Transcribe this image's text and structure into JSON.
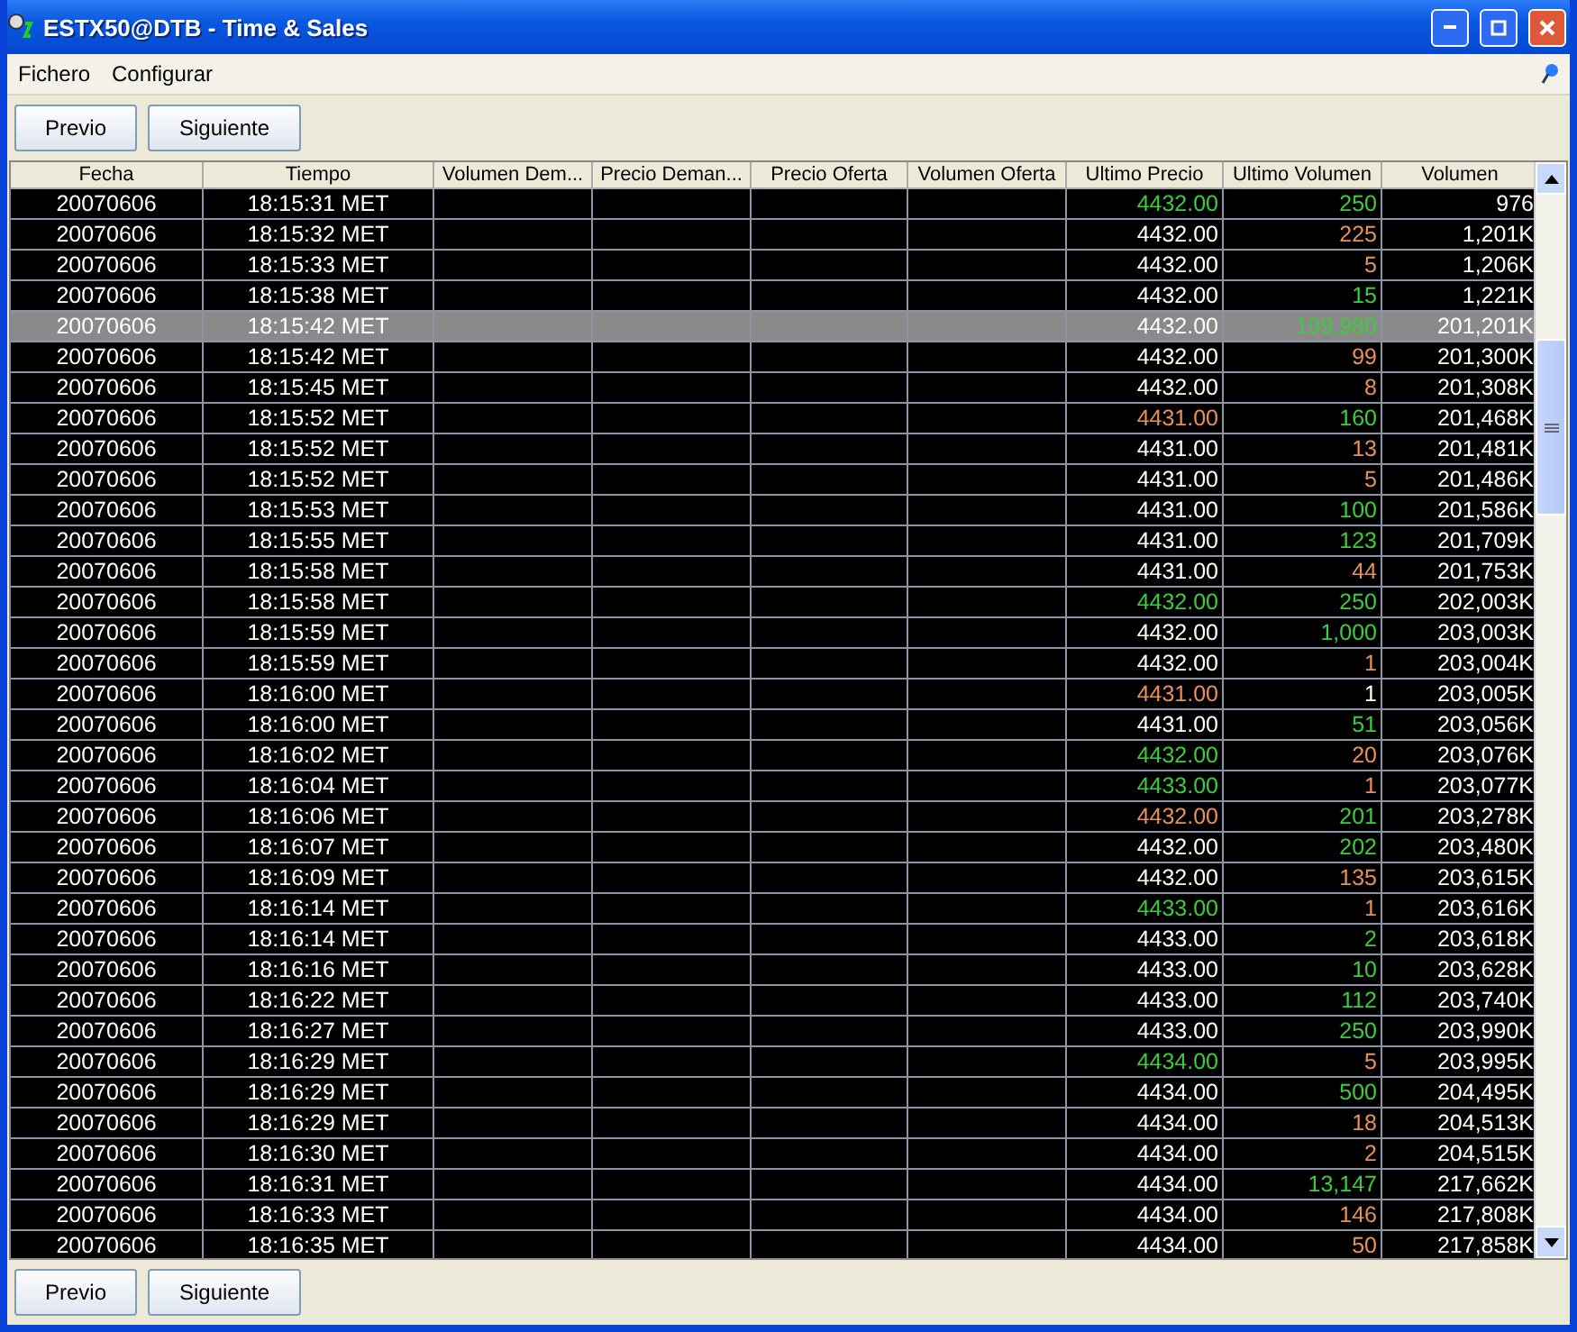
{
  "window": {
    "title": "ESTX50@DTB - Time & Sales"
  },
  "menu": [
    "Fichero",
    "Configurar"
  ],
  "top_buttons": [
    "Previo",
    "Siguiente"
  ],
  "table": {
    "columns": [
      "Fecha",
      "Tiempo",
      "Volumen Dem...",
      "Precio Deman...",
      "Precio Oferta",
      "Volumen Oferta",
      "Ultimo Precio",
      "Ultimo Volumen",
      "Volumen"
    ],
    "rows": [
      {
        "date": "20070606",
        "time": "18:15:31 MET",
        "price": {
          "text": "4432.00",
          "rising": true,
          "falling": false
        },
        "last_volume": {
          "text": "250",
          "rising": true,
          "falling": false
        },
        "volume": "976",
        "selected": false
      },
      {
        "date": "20070606",
        "time": "18:15:32 MET",
        "price": {
          "text": "4432.00",
          "rising": false,
          "falling": false
        },
        "last_volume": {
          "text": "225",
          "rising": false,
          "falling": true
        },
        "volume": "1,201K",
        "selected": false
      },
      {
        "date": "20070606",
        "time": "18:15:33 MET",
        "price": {
          "text": "4432.00",
          "rising": false,
          "falling": false
        },
        "last_volume": {
          "text": "5",
          "rising": false,
          "falling": true
        },
        "volume": "1,206K",
        "selected": false
      },
      {
        "date": "20070606",
        "time": "18:15:38 MET",
        "price": {
          "text": "4432.00",
          "rising": false,
          "falling": false
        },
        "last_volume": {
          "text": "15",
          "rising": true,
          "falling": false
        },
        "volume": "1,221K",
        "selected": false
      },
      {
        "date": "20070606",
        "time": "18:15:42 MET",
        "price": {
          "text": "4432.00",
          "rising": false,
          "falling": false
        },
        "last_volume": {
          "text": "199,980",
          "rising": true,
          "falling": false
        },
        "volume": "201,201K",
        "selected": true
      },
      {
        "date": "20070606",
        "time": "18:15:42 MET",
        "price": {
          "text": "4432.00",
          "rising": false,
          "falling": false
        },
        "last_volume": {
          "text": "99",
          "rising": false,
          "falling": true
        },
        "volume": "201,300K",
        "selected": false
      },
      {
        "date": "20070606",
        "time": "18:15:45 MET",
        "price": {
          "text": "4432.00",
          "rising": false,
          "falling": false
        },
        "last_volume": {
          "text": "8",
          "rising": false,
          "falling": true
        },
        "volume": "201,308K",
        "selected": false
      },
      {
        "date": "20070606",
        "time": "18:15:52 MET",
        "price": {
          "text": "4431.00",
          "rising": false,
          "falling": true
        },
        "last_volume": {
          "text": "160",
          "rising": true,
          "falling": false
        },
        "volume": "201,468K",
        "selected": false
      },
      {
        "date": "20070606",
        "time": "18:15:52 MET",
        "price": {
          "text": "4431.00",
          "rising": false,
          "falling": false
        },
        "last_volume": {
          "text": "13",
          "rising": false,
          "falling": true
        },
        "volume": "201,481K",
        "selected": false
      },
      {
        "date": "20070606",
        "time": "18:15:52 MET",
        "price": {
          "text": "4431.00",
          "rising": false,
          "falling": false
        },
        "last_volume": {
          "text": "5",
          "rising": false,
          "falling": true
        },
        "volume": "201,486K",
        "selected": false
      },
      {
        "date": "20070606",
        "time": "18:15:53 MET",
        "price": {
          "text": "4431.00",
          "rising": false,
          "falling": false
        },
        "last_volume": {
          "text": "100",
          "rising": true,
          "falling": false
        },
        "volume": "201,586K",
        "selected": false
      },
      {
        "date": "20070606",
        "time": "18:15:55 MET",
        "price": {
          "text": "4431.00",
          "rising": false,
          "falling": false
        },
        "last_volume": {
          "text": "123",
          "rising": true,
          "falling": false
        },
        "volume": "201,709K",
        "selected": false
      },
      {
        "date": "20070606",
        "time": "18:15:58 MET",
        "price": {
          "text": "4431.00",
          "rising": false,
          "falling": false
        },
        "last_volume": {
          "text": "44",
          "rising": false,
          "falling": true
        },
        "volume": "201,753K",
        "selected": false
      },
      {
        "date": "20070606",
        "time": "18:15:58 MET",
        "price": {
          "text": "4432.00",
          "rising": true,
          "falling": false
        },
        "last_volume": {
          "text": "250",
          "rising": true,
          "falling": false
        },
        "volume": "202,003K",
        "selected": false
      },
      {
        "date": "20070606",
        "time": "18:15:59 MET",
        "price": {
          "text": "4432.00",
          "rising": false,
          "falling": false
        },
        "last_volume": {
          "text": "1,000",
          "rising": true,
          "falling": false
        },
        "volume": "203,003K",
        "selected": false
      },
      {
        "date": "20070606",
        "time": "18:15:59 MET",
        "price": {
          "text": "4432.00",
          "rising": false,
          "falling": false
        },
        "last_volume": {
          "text": "1",
          "rising": false,
          "falling": true
        },
        "volume": "203,004K",
        "selected": false
      },
      {
        "date": "20070606",
        "time": "18:16:00 MET",
        "price": {
          "text": "4431.00",
          "rising": false,
          "falling": true
        },
        "last_volume": {
          "text": "1",
          "rising": false,
          "falling": false
        },
        "volume": "203,005K",
        "selected": false
      },
      {
        "date": "20070606",
        "time": "18:16:00 MET",
        "price": {
          "text": "4431.00",
          "rising": false,
          "falling": false
        },
        "last_volume": {
          "text": "51",
          "rising": true,
          "falling": false
        },
        "volume": "203,056K",
        "selected": false
      },
      {
        "date": "20070606",
        "time": "18:16:02 MET",
        "price": {
          "text": "4432.00",
          "rising": true,
          "falling": false
        },
        "last_volume": {
          "text": "20",
          "rising": false,
          "falling": true
        },
        "volume": "203,076K",
        "selected": false
      },
      {
        "date": "20070606",
        "time": "18:16:04 MET",
        "price": {
          "text": "4433.00",
          "rising": true,
          "falling": false
        },
        "last_volume": {
          "text": "1",
          "rising": false,
          "falling": true
        },
        "volume": "203,077K",
        "selected": false
      },
      {
        "date": "20070606",
        "time": "18:16:06 MET",
        "price": {
          "text": "4432.00",
          "rising": false,
          "falling": true
        },
        "last_volume": {
          "text": "201",
          "rising": true,
          "falling": false
        },
        "volume": "203,278K",
        "selected": false
      },
      {
        "date": "20070606",
        "time": "18:16:07 MET",
        "price": {
          "text": "4432.00",
          "rising": false,
          "falling": false
        },
        "last_volume": {
          "text": "202",
          "rising": true,
          "falling": false
        },
        "volume": "203,480K",
        "selected": false
      },
      {
        "date": "20070606",
        "time": "18:16:09 MET",
        "price": {
          "text": "4432.00",
          "rising": false,
          "falling": false
        },
        "last_volume": {
          "text": "135",
          "rising": false,
          "falling": true
        },
        "volume": "203,615K",
        "selected": false
      },
      {
        "date": "20070606",
        "time": "18:16:14 MET",
        "price": {
          "text": "4433.00",
          "rising": true,
          "falling": false
        },
        "last_volume": {
          "text": "1",
          "rising": false,
          "falling": true
        },
        "volume": "203,616K",
        "selected": false
      },
      {
        "date": "20070606",
        "time": "18:16:14 MET",
        "price": {
          "text": "4433.00",
          "rising": false,
          "falling": false
        },
        "last_volume": {
          "text": "2",
          "rising": true,
          "falling": false
        },
        "volume": "203,618K",
        "selected": false
      },
      {
        "date": "20070606",
        "time": "18:16:16 MET",
        "price": {
          "text": "4433.00",
          "rising": false,
          "falling": false
        },
        "last_volume": {
          "text": "10",
          "rising": true,
          "falling": false
        },
        "volume": "203,628K",
        "selected": false
      },
      {
        "date": "20070606",
        "time": "18:16:22 MET",
        "price": {
          "text": "4433.00",
          "rising": false,
          "falling": false
        },
        "last_volume": {
          "text": "112",
          "rising": true,
          "falling": false
        },
        "volume": "203,740K",
        "selected": false
      },
      {
        "date": "20070606",
        "time": "18:16:27 MET",
        "price": {
          "text": "4433.00",
          "rising": false,
          "falling": false
        },
        "last_volume": {
          "text": "250",
          "rising": true,
          "falling": false
        },
        "volume": "203,990K",
        "selected": false
      },
      {
        "date": "20070606",
        "time": "18:16:29 MET",
        "price": {
          "text": "4434.00",
          "rising": true,
          "falling": false
        },
        "last_volume": {
          "text": "5",
          "rising": false,
          "falling": true
        },
        "volume": "203,995K",
        "selected": false
      },
      {
        "date": "20070606",
        "time": "18:16:29 MET",
        "price": {
          "text": "4434.00",
          "rising": false,
          "falling": false
        },
        "last_volume": {
          "text": "500",
          "rising": true,
          "falling": false
        },
        "volume": "204,495K",
        "selected": false
      },
      {
        "date": "20070606",
        "time": "18:16:29 MET",
        "price": {
          "text": "4434.00",
          "rising": false,
          "falling": false
        },
        "last_volume": {
          "text": "18",
          "rising": false,
          "falling": true
        },
        "volume": "204,513K",
        "selected": false
      },
      {
        "date": "20070606",
        "time": "18:16:30 MET",
        "price": {
          "text": "4434.00",
          "rising": false,
          "falling": false
        },
        "last_volume": {
          "text": "2",
          "rising": false,
          "falling": true
        },
        "volume": "204,515K",
        "selected": false
      },
      {
        "date": "20070606",
        "time": "18:16:31 MET",
        "price": {
          "text": "4434.00",
          "rising": false,
          "falling": false
        },
        "last_volume": {
          "text": "13,147",
          "rising": true,
          "falling": false
        },
        "volume": "217,662K",
        "selected": false
      },
      {
        "date": "20070606",
        "time": "18:16:33 MET",
        "price": {
          "text": "4434.00",
          "rising": false,
          "falling": false
        },
        "last_volume": {
          "text": "146",
          "rising": false,
          "falling": true
        },
        "volume": "217,808K",
        "selected": false
      },
      {
        "date": "20070606",
        "time": "18:16:35 MET",
        "price": {
          "text": "4434.00",
          "rising": false,
          "falling": false
        },
        "last_volume": {
          "text": "50",
          "rising": false,
          "falling": true
        },
        "volume": "217,858K",
        "selected": false
      }
    ]
  },
  "bottom_buttons": [
    "Previo",
    "Siguiente"
  ]
}
